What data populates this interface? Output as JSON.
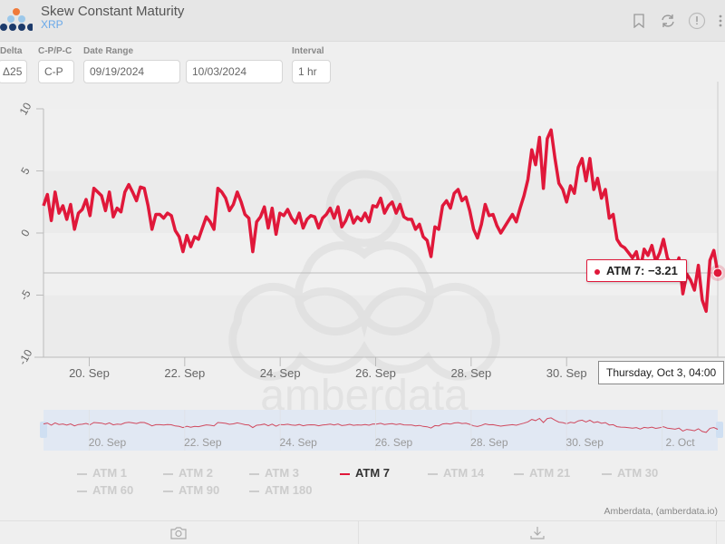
{
  "header": {
    "title": "Skew Constant Maturity",
    "subtitle": "XRP",
    "icons": [
      "bookmark-icon",
      "refresh-icon",
      "info-icon",
      "more-vertical-icon"
    ]
  },
  "controls": {
    "delta": {
      "label": "Delta",
      "value": "Δ25"
    },
    "cp": {
      "label": "C-P/P-C",
      "value": "C-P"
    },
    "date_range": {
      "label": "Date Range",
      "start": "09/19/2024",
      "end": "10/03/2024"
    },
    "interval": {
      "label": "Interval",
      "value": "1 hr"
    }
  },
  "watermark": "amberdata",
  "tooltip": {
    "series_label": "ATM 7: ",
    "value_text": "−3.21",
    "date_text": "Thursday, Oct 3, 04:00"
  },
  "credits": "Amberdata, (amberdata.io)",
  "footer": {
    "icons": [
      "camera-icon",
      "download-icon"
    ]
  },
  "colors": {
    "series": "#e0183a",
    "inactive": "#cccccc",
    "subtitle": "#6aa9e9"
  },
  "chart_data": {
    "type": "line",
    "title": "Skew Constant Maturity",
    "subtitle": "XRP",
    "xlabel": "",
    "ylabel": "",
    "ylim": [
      -10,
      10
    ],
    "yticks": [
      10,
      5,
      0,
      -5,
      -10
    ],
    "xticks": [
      "20. Sep",
      "22. Sep",
      "24. Sep",
      "26. Sep",
      "28. Sep",
      "30. Sep"
    ],
    "navigator_xticks": [
      "20. Sep",
      "22. Sep",
      "24. Sep",
      "26. Sep",
      "28. Sep",
      "30. Sep",
      "2. Oct"
    ],
    "x_start": "2024-09-19T01:00",
    "x_end": "2024-10-03T04:00",
    "x_step_hours": 4,
    "grid": "alternating horizontal bands",
    "crosshair_y": -3.21,
    "legend_position": "bottom",
    "legend": [
      "ATM 1",
      "ATM 2",
      "ATM 3",
      "ATM 7",
      "ATM 14",
      "ATM 21",
      "ATM 30",
      "ATM 60",
      "ATM 90",
      "ATM 180"
    ],
    "active_series": "ATM 7",
    "series": [
      {
        "name": "ATM 7",
        "values": [
          2.2,
          3.1,
          1.0,
          3.3,
          1.6,
          2.2,
          1.1,
          2.3,
          0.3,
          1.6,
          1.9,
          2.7,
          1.4,
          3.6,
          3.3,
          3.0,
          1.8,
          3.3,
          1.3,
          2.0,
          1.7,
          3.3,
          3.9,
          3.3,
          2.6,
          3.7,
          3.6,
          2.2,
          0.3,
          1.5,
          1.5,
          1.2,
          1.6,
          1.4,
          0.2,
          -0.3,
          -1.5,
          -0.2,
          -1.1,
          -0.3,
          -0.5,
          0.4,
          1.3,
          0.9,
          0.3,
          3.6,
          3.3,
          2.8,
          1.8,
          2.3,
          3.3,
          2.5,
          1.5,
          1.2,
          -1.5,
          0.9,
          1.3,
          2.1,
          0.4,
          2.0,
          -0.1,
          1.6,
          1.4,
          1.9,
          1.2,
          0.8,
          1.6,
          0.4,
          1.1,
          1.4,
          1.3,
          0.4,
          1.2,
          1.5,
          2.0,
          1.2,
          2.1,
          0.5,
          1.0,
          1.8,
          0.8,
          1.3,
          1.0,
          1.6,
          0.9,
          2.2,
          2.1,
          2.8,
          1.6,
          2.2,
          2.5,
          1.6,
          2.3,
          1.3,
          1.1,
          1.1,
          0.3,
          0.7,
          -0.3,
          -0.6,
          -1.9,
          0.5,
          0.3,
          2.2,
          2.6,
          2.0,
          3.2,
          3.5,
          2.6,
          2.9,
          1.8,
          0.3,
          -0.4,
          0.7,
          2.3,
          1.4,
          1.5,
          0.6,
          0.0,
          0.5,
          1.0,
          1.5,
          0.9,
          2.0,
          3.0,
          4.3,
          6.7,
          5.5,
          7.7,
          3.6,
          7.6,
          8.3,
          6.0,
          4.0,
          3.5,
          2.5,
          3.8,
          3.2,
          5.3,
          6.0,
          4.2,
          6.0,
          3.5,
          4.4,
          2.8,
          3.5,
          1.2,
          1.5,
          -0.5,
          -1.0,
          -1.2,
          -1.6,
          -2.0,
          -1.5,
          -2.9,
          -1.3,
          -1.8,
          -1.0,
          -2.3,
          -1.6,
          -0.5,
          -2.0,
          -2.5,
          -3.1,
          -2.0,
          -4.9,
          -3.3,
          -3.8,
          -4.6,
          -2.6,
          -5.4,
          -6.3,
          -2.2,
          -1.4,
          -3.21
        ]
      }
    ]
  }
}
